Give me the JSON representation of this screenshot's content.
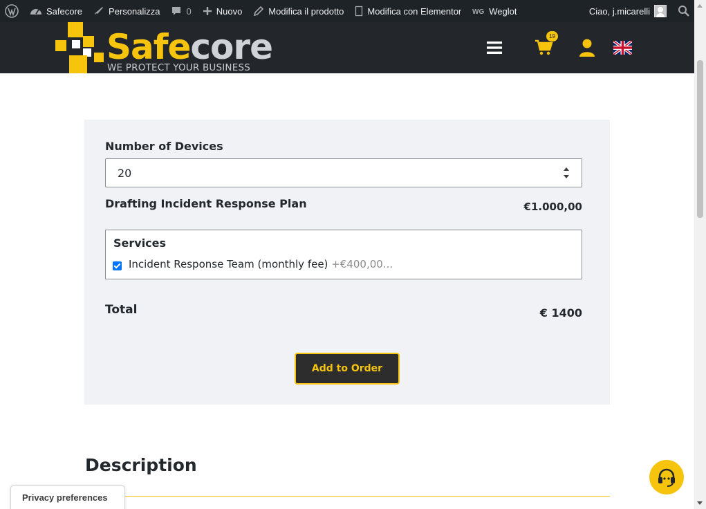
{
  "adminbar": {
    "site_name": "Safecore",
    "customize": "Personalizza",
    "comments_count": "0",
    "new": "Nuovo",
    "edit_product": "Modifica il prodotto",
    "edit_elementor": "Modifica con Elementor",
    "weglot": "Weglot",
    "greeting": "Ciao, j.micarelli"
  },
  "header": {
    "logo_safe": "Safe",
    "logo_core": "core",
    "tagline": "WE PROTECT YOUR BUSINESS",
    "cart_count": "19",
    "language": "English (UK flag)"
  },
  "form": {
    "devices_label": "Number of Devices",
    "devices_value": "20",
    "plan_label": "Drafting Incident Response Plan",
    "plan_price": "€1.000,00",
    "services_label": "Services",
    "service_item": "Incident Response Team (monthly fee)",
    "service_item_price": "+€400,00...",
    "service_checked": true,
    "total_label": "Total",
    "total_value": "€ 1400",
    "add_button": "Add to Order"
  },
  "content": {
    "description_title": "Description"
  },
  "privacy": {
    "label": "Privacy preferences"
  },
  "colors": {
    "brand_yellow": "#f6c40c",
    "header_bg": "#23272c",
    "adminbar_bg": "#1d2327",
    "panel_bg": "#f1f2f6",
    "checkbox_blue": "#0075ff"
  },
  "icons": [
    "wordpress-icon",
    "dashboard-icon",
    "brush-icon",
    "comment-icon",
    "plus-icon",
    "pencil-icon",
    "page-icon",
    "weglot-icon",
    "search-icon",
    "hamburger-icon",
    "cart-icon",
    "user-icon",
    "uk-flag-icon",
    "headset-icon"
  ]
}
